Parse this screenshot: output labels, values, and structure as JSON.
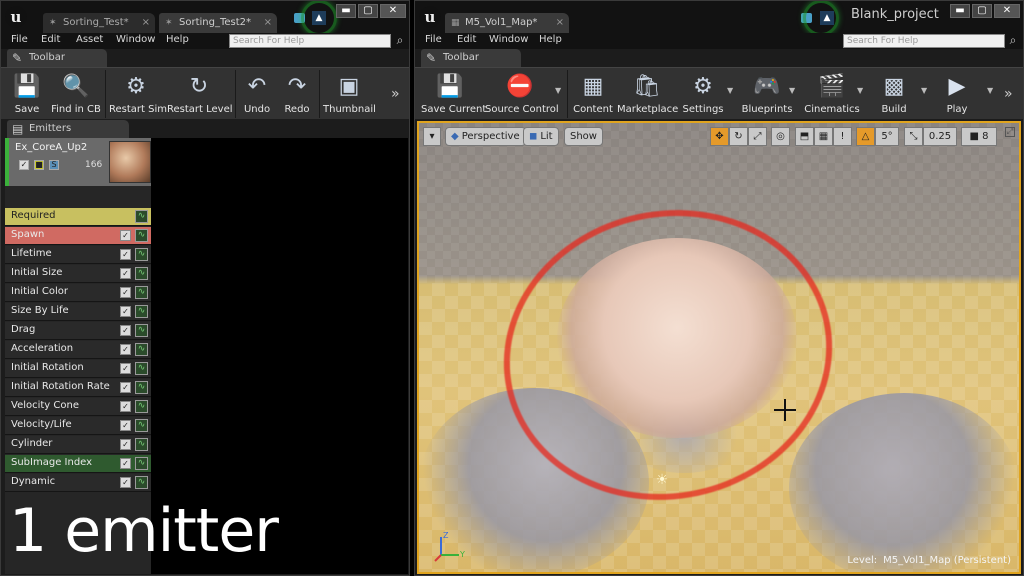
{
  "left_window": {
    "tabs": [
      {
        "label": "Sorting_Test"
      },
      {
        "label": "Sorting_Test2"
      }
    ],
    "tab_modified_marks": [
      "*",
      "*"
    ],
    "close_mark": "×",
    "menu": [
      "File",
      "Edit",
      "Asset",
      "Window",
      "Help"
    ],
    "search_placeholder": "Search For Help",
    "toolbar_tab": "Toolbar",
    "toolbar": [
      {
        "label": "Save",
        "icon": "save-icon"
      },
      {
        "label": "Find in CB",
        "icon": "find-in-cb-icon"
      },
      {
        "label": "Restart Sim",
        "icon": "restart-sim-icon"
      },
      {
        "label": "Restart Level",
        "icon": "restart-level-icon"
      },
      {
        "label": "Undo",
        "icon": "undo-icon"
      },
      {
        "label": "Redo",
        "icon": "redo-icon"
      },
      {
        "label": "Thumbnail",
        "icon": "thumbnail-icon"
      }
    ],
    "emitters_tab": "Emitters",
    "emitter": {
      "name": "Ex_CoreA_Up2",
      "count": "166"
    },
    "modules": [
      {
        "label": "Required",
        "style": "required"
      },
      {
        "label": "Spawn",
        "style": "spawn"
      },
      {
        "label": "Lifetime",
        "style": ""
      },
      {
        "label": "Initial Size",
        "style": ""
      },
      {
        "label": "Initial Color",
        "style": ""
      },
      {
        "label": "Size By Life",
        "style": ""
      },
      {
        "label": "Drag",
        "style": ""
      },
      {
        "label": "Acceleration",
        "style": ""
      },
      {
        "label": "Initial Rotation",
        "style": ""
      },
      {
        "label": "Initial Rotation Rate",
        "style": ""
      },
      {
        "label": "Velocity Cone",
        "style": ""
      },
      {
        "label": "Velocity/Life",
        "style": ""
      },
      {
        "label": "Cylinder",
        "style": ""
      },
      {
        "label": "SubImage Index",
        "style": "subimage"
      },
      {
        "label": "Dynamic",
        "style": ""
      }
    ],
    "caption": "1 emitter"
  },
  "right_window": {
    "tab": {
      "label": "M5_Vol1_Map"
    },
    "tab_modified_mark": "*",
    "close_mark": "×",
    "project_name": "Blank_project",
    "menu": [
      "File",
      "Edit",
      "Window",
      "Help"
    ],
    "search_placeholder": "Search For Help",
    "toolbar_tab": "Toolbar",
    "toolbar": [
      {
        "label": "Save Current",
        "icon": "save-current-icon"
      },
      {
        "label": "Source Control",
        "icon": "source-control-icon"
      },
      {
        "label": "Content",
        "icon": "content-icon"
      },
      {
        "label": "Marketplace",
        "icon": "marketplace-icon"
      },
      {
        "label": "Settings",
        "icon": "settings-icon"
      },
      {
        "label": "Blueprints",
        "icon": "blueprints-icon"
      },
      {
        "label": "Cinematics",
        "icon": "cinematics-icon"
      },
      {
        "label": "Build",
        "icon": "build-icon"
      },
      {
        "label": "Play",
        "icon": "play-icon"
      }
    ],
    "viewport": {
      "perspective": "Perspective",
      "lit": "Lit",
      "show": "Show",
      "snap_angle": "5°",
      "scale_snap": "0.25",
      "camera_speed": "8",
      "level_key": "Level:",
      "level_value": "M5_Vol1_Map (Persistent)"
    }
  },
  "colors": {
    "viewport_border": "#e0a41e",
    "required": "#c8c060",
    "spawn": "#d06a62",
    "subimage": "#2f5a2f",
    "emitter_enabled": "#3bb13b",
    "annotation": "#e6281e"
  }
}
